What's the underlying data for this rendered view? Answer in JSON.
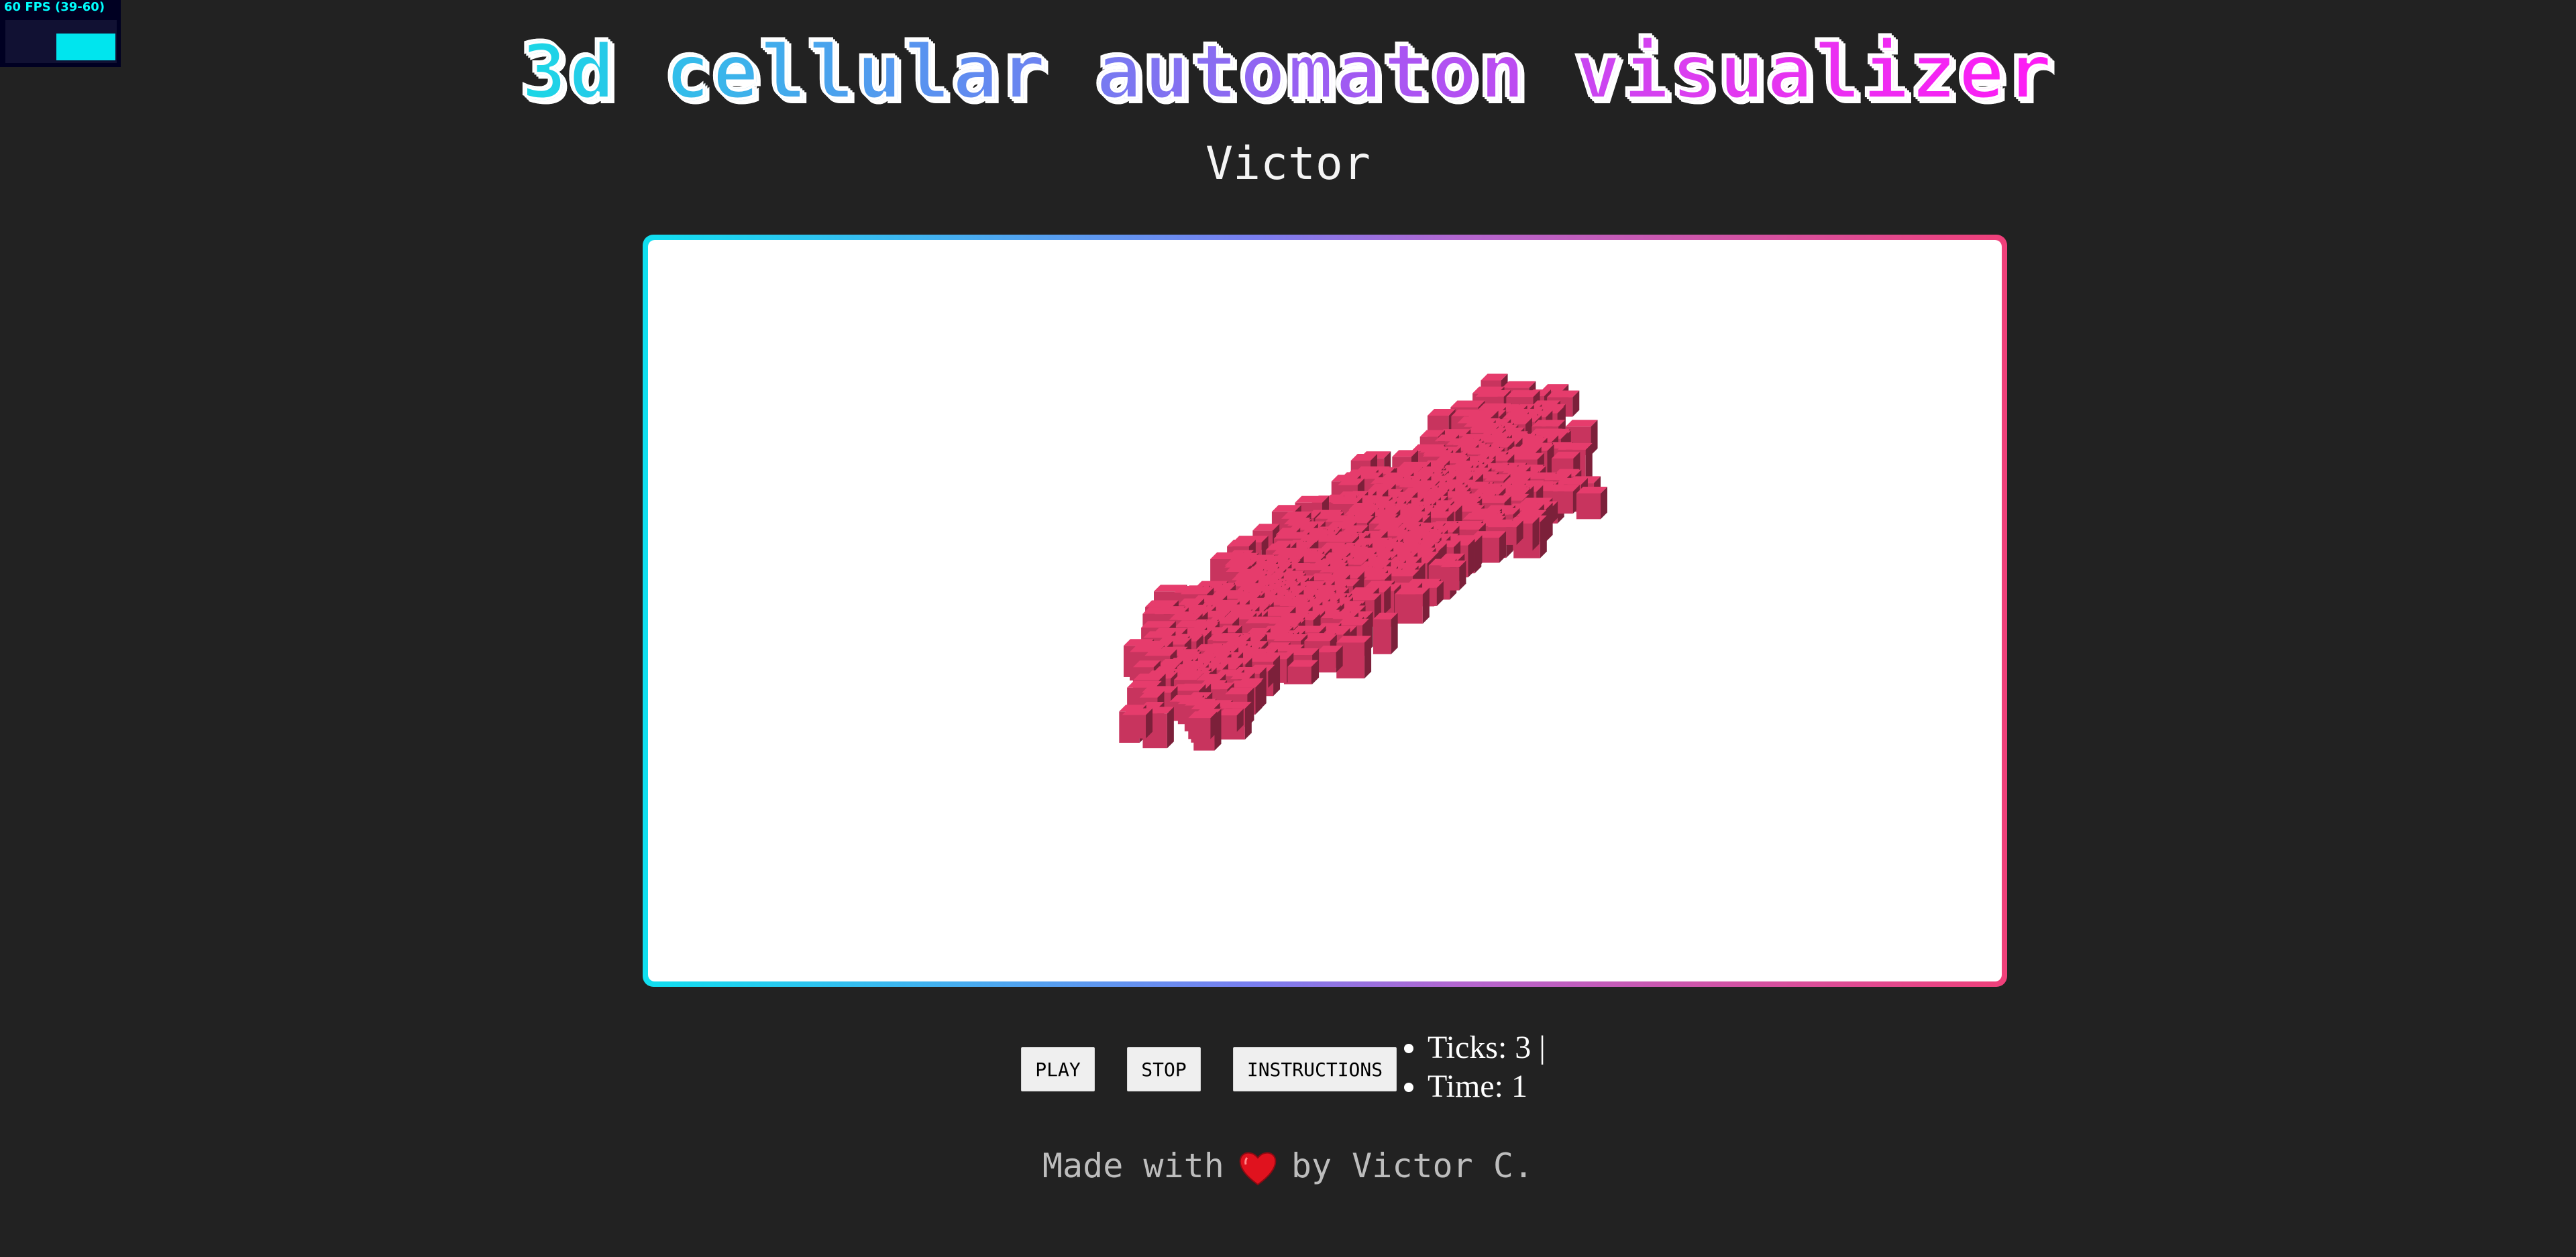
{
  "stats": {
    "fps_label": "60 FPS (39-60)"
  },
  "header": {
    "title": "3D Cellular Automaton Visualizer",
    "subtitle": "Victor"
  },
  "canvas": {
    "frame_gradient": [
      "#10e0f0",
      "#f0407a"
    ],
    "voxel_color": "#c8345e"
  },
  "controls": {
    "play_label": "PLAY",
    "stop_label": "STOP",
    "instructions_label": "INSTRUCTIONS"
  },
  "status": {
    "ticks": "Ticks: 3 |",
    "time": "Time: 1"
  },
  "footer": {
    "made_with": "Made with",
    "heart_icon": "heart-icon",
    "by_author": "by Victor C."
  }
}
